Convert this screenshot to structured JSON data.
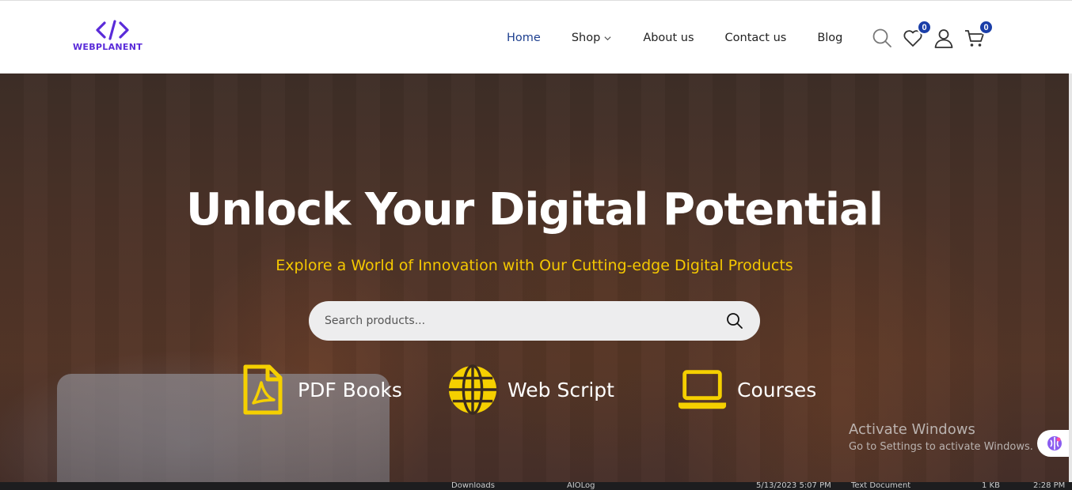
{
  "brand": {
    "name": "WEBPLANENT",
    "color": "#5a2bd9"
  },
  "nav": {
    "items": [
      {
        "label": "Home",
        "active": true
      },
      {
        "label": "Shop",
        "dropdown": true
      },
      {
        "label": "About us"
      },
      {
        "label": "Contact us"
      },
      {
        "label": "Blog"
      }
    ]
  },
  "header_icons": {
    "search": "search-icon",
    "wishlist": {
      "icon": "heart-icon",
      "count": "0"
    },
    "account": "user-icon",
    "cart": {
      "icon": "cart-icon",
      "count": "0"
    }
  },
  "hero": {
    "title": "Unlock Your Digital Potential",
    "subtitle": "Explore a World of Innovation with Our Cutting-edge Digital Products",
    "search_placeholder": "Search products...",
    "accent": "#f5c800",
    "categories": [
      {
        "label": "PDF Books",
        "icon": "pdf-file-icon"
      },
      {
        "label": "Web Script",
        "icon": "globe-icon"
      },
      {
        "label": "Courses",
        "icon": "laptop-icon"
      }
    ]
  },
  "windows_watermark": {
    "title": "Activate Windows",
    "subtitle": "Go to Settings to activate Windows."
  },
  "taskbar": {
    "items": [
      "Downloads",
      "AIOLog",
      "5/13/2023 5:07 PM",
      "Text Document",
      "1 KB",
      "2:28 PM"
    ]
  }
}
